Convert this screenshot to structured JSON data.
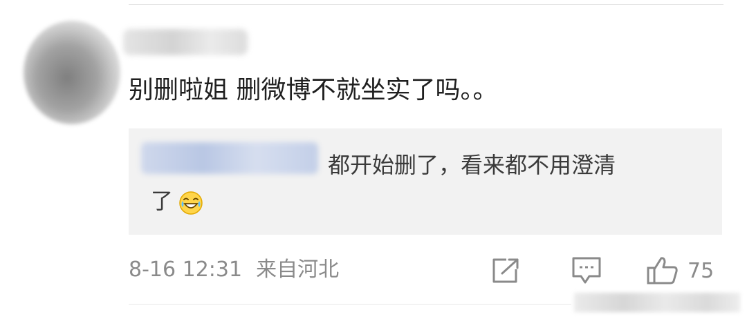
{
  "comment": {
    "text": "别删啦姐 删微博不就坐实了吗。。"
  },
  "reply": {
    "line1": "都开始删了，看来都不用澄清",
    "line2": "了"
  },
  "meta": {
    "timestamp": "8-16 12:31",
    "location": "来自河北"
  },
  "actions": {
    "like_count": "75"
  },
  "icons": {
    "share": "share-icon",
    "comment": "comment-icon",
    "like": "thumbs-up-icon",
    "emoji": "laugh-cry-emoji-icon"
  },
  "colors": {
    "reply_background": "#f2f2f2",
    "meta_text": "#8a8a8a",
    "icon_stroke": "#8a8a8a"
  }
}
